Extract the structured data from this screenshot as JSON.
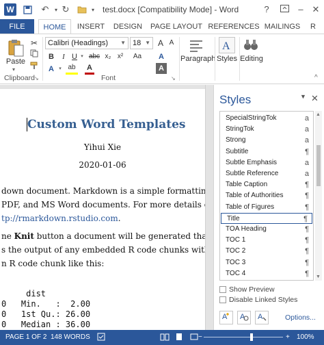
{
  "titlebar": {
    "doc_title": "test.docx [Compatibility Mode] - Word",
    "logo_letter": "W",
    "help": "?",
    "minimize": "–",
    "close": "✕"
  },
  "tabs": [
    "FILE",
    "HOME",
    "INSERT",
    "DESIGN",
    "PAGE LAYOUT",
    "REFERENCES",
    "MAILINGS",
    "R"
  ],
  "ribbon": {
    "clipboard_label": "Clipboard",
    "paste_label": "Paste",
    "font_label": "Font",
    "font_name": "Calibri (Headings)",
    "font_size": "18",
    "bold": "B",
    "italic": "I",
    "underline": "U",
    "strikethrough": "abc",
    "subscript": "x₂",
    "superscript": "x²",
    "grow_font": "A",
    "shrink_font": "A",
    "case": "Aa",
    "clear_format": "A",
    "text_effects": "A",
    "highlight": "ab",
    "font_color": "A",
    "paragraph_label": "Paragraph",
    "styles_label": "Styles",
    "editing_label": "Editing"
  },
  "document": {
    "title": "Custom Word Templates",
    "author": "Yihui Xie",
    "date": "2020-01-06",
    "para1_line1": "down document. Markdown is a simple formatting sy",
    "para1_line2": "PDF, and MS Word documents. For more details on u",
    "para1_link": "tp://rmarkdown.rstudio.com",
    "para1_link_tail": ".",
    "para2_line1_pre": "ne ",
    "para2_line1_bold": "Knit",
    "para2_line1_post": " button a document will be generated that incl",
    "para2_line2": "s the output of any embedded R code chunks within th",
    "para2_line3": "n R code chunk like this:",
    "code_header": "     dist",
    "code_line1": "0   Min.   :  2.00",
    "code_line2": "0   1st Qu.: 26.00",
    "code_line3": "0   Median : 36.00"
  },
  "styles_pane": {
    "title": "Styles",
    "items": [
      {
        "name": "SpecialStringTok",
        "mark": "a"
      },
      {
        "name": "StringTok",
        "mark": "a"
      },
      {
        "name": "Strong",
        "mark": "a"
      },
      {
        "name": "Subtitle",
        "mark": "¶"
      },
      {
        "name": "Subtle Emphasis",
        "mark": "a"
      },
      {
        "name": "Subtle Reference",
        "mark": "a"
      },
      {
        "name": "Table Caption",
        "mark": "¶"
      },
      {
        "name": "Table of Authorities",
        "mark": "¶"
      },
      {
        "name": "Table of Figures",
        "mark": "¶"
      },
      {
        "name": "Title",
        "mark": "¶"
      },
      {
        "name": "TOA Heading",
        "mark": "¶"
      },
      {
        "name": "TOC 1",
        "mark": "¶"
      },
      {
        "name": "TOC 2",
        "mark": "¶"
      },
      {
        "name": "TOC 3",
        "mark": "¶"
      },
      {
        "name": "TOC 4",
        "mark": "¶"
      }
    ],
    "selected": "Title",
    "show_preview": "Show Preview",
    "disable_linked": "Disable Linked Styles",
    "options": "Options..."
  },
  "statusbar": {
    "page": "PAGE 1 OF 2",
    "words": "148 WORDS",
    "zoom": "100%",
    "zoom_value_percent": 100
  },
  "colors": {
    "accent": "#2b579a",
    "heading": "#365f91"
  }
}
